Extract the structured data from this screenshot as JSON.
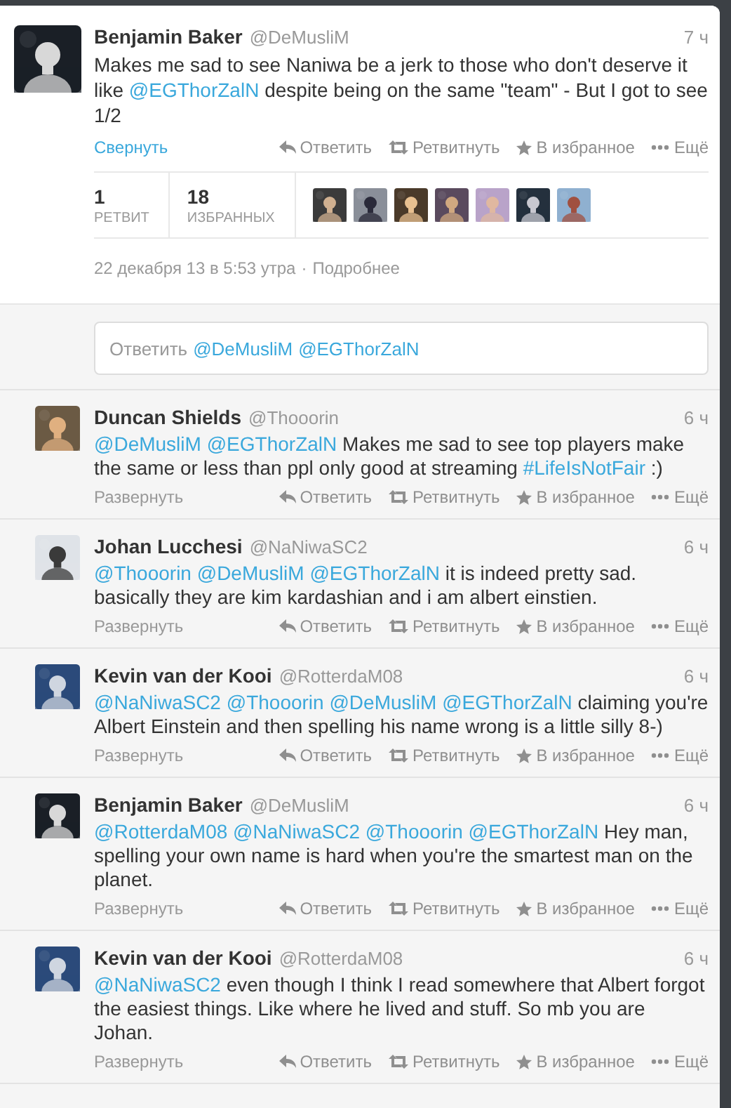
{
  "main_tweet": {
    "name": "Benjamin Baker",
    "handle": "@DeMusliM",
    "time": "7 ч",
    "text": [
      {
        "kind": "text",
        "text": "Makes me sad to see Naniwa be a jerk to those who don't deserve it like "
      },
      {
        "kind": "mention",
        "text": "@EGThorZalN"
      },
      {
        "kind": "text",
        "text": " despite being on the same \"team\" - But I got to see 1/2"
      }
    ],
    "toggle": {
      "label": "Свернуть",
      "expanded": true
    },
    "actions": [
      {
        "kind": "reply",
        "label": "Ответить"
      },
      {
        "kind": "retweet",
        "label": "Ретвитнуть"
      },
      {
        "kind": "favorite",
        "label": "В избранное"
      },
      {
        "kind": "more",
        "label": "Ещё"
      }
    ],
    "stats": [
      {
        "count": "1",
        "label": "РЕТВИТ"
      },
      {
        "count": "18",
        "label": "ИЗБРАННЫХ"
      }
    ],
    "date": "22 декабря 13 в 5:53 утра",
    "separator": "·",
    "details_link": "Подробнее"
  },
  "reply_box": {
    "prompt": "Ответить",
    "mentions": [
      "@DeMusliM",
      "@EGThorZalN"
    ]
  },
  "replies": [
    {
      "name": "Duncan Shields",
      "handle": "@Thooorin",
      "time": "6 ч",
      "text": [
        {
          "kind": "mention",
          "text": "@DeMusliM "
        },
        {
          "kind": "mention",
          "text": "@EGThorZalN"
        },
        {
          "kind": "text",
          "text": " Makes me sad to see top players make the same or less than ppl only good at streaming "
        },
        {
          "kind": "mention",
          "text": "#LifeIsNotFair"
        },
        {
          "kind": "text",
          "text": " :)"
        }
      ],
      "toggle": {
        "label": "Развернуть",
        "expanded": false
      },
      "actions": [
        {
          "kind": "reply",
          "label": "Ответить"
        },
        {
          "kind": "retweet",
          "label": "Ретвитнуть"
        },
        {
          "kind": "favorite",
          "label": "В избранное"
        },
        {
          "kind": "more",
          "label": "Ещё"
        }
      ]
    },
    {
      "name": "Johan Lucchesi",
      "handle": "@NaNiwaSC2",
      "time": "6 ч",
      "text": [
        {
          "kind": "mention",
          "text": "@Thooorin "
        },
        {
          "kind": "mention",
          "text": "@DeMusliM "
        },
        {
          "kind": "mention",
          "text": "@EGThorZalN"
        },
        {
          "kind": "text",
          "text": " it is indeed pretty sad. basically they are kim kardashian and i am albert einstien."
        }
      ],
      "toggle": {
        "label": "Развернуть",
        "expanded": false
      },
      "actions": [
        {
          "kind": "reply",
          "label": "Ответить"
        },
        {
          "kind": "retweet",
          "label": "Ретвитнуть"
        },
        {
          "kind": "favorite",
          "label": "В избранное"
        },
        {
          "kind": "more",
          "label": "Ещё"
        }
      ]
    },
    {
      "name": "Kevin van der Kooi",
      "handle": "@RotterdaM08",
      "time": "6 ч",
      "text": [
        {
          "kind": "mention",
          "text": "@NaNiwaSC2 "
        },
        {
          "kind": "mention",
          "text": "@Thooorin "
        },
        {
          "kind": "mention",
          "text": "@DeMusliM "
        },
        {
          "kind": "mention",
          "text": "@EGThorZalN"
        },
        {
          "kind": "text",
          "text": " claiming you're Albert Einstein and then spelling his name wrong is a little silly 8-)"
        }
      ],
      "toggle": {
        "label": "Развернуть",
        "expanded": false
      },
      "actions": [
        {
          "kind": "reply",
          "label": "Ответить"
        },
        {
          "kind": "retweet",
          "label": "Ретвитнуть"
        },
        {
          "kind": "favorite",
          "label": "В избранное"
        },
        {
          "kind": "more",
          "label": "Ещё"
        }
      ]
    },
    {
      "name": "Benjamin Baker",
      "handle": "@DeMusliM",
      "time": "6 ч",
      "text": [
        {
          "kind": "mention",
          "text": "@RotterdaM08 "
        },
        {
          "kind": "mention",
          "text": "@NaNiwaSC2 "
        },
        {
          "kind": "mention",
          "text": "@Thooorin "
        },
        {
          "kind": "mention",
          "text": "@EGThorZalN"
        },
        {
          "kind": "text",
          "text": " Hey man, spelling your own name is hard when you're the smartest man on the planet."
        }
      ],
      "toggle": {
        "label": "Развернуть",
        "expanded": false
      },
      "actions": [
        {
          "kind": "reply",
          "label": "Ответить"
        },
        {
          "kind": "retweet",
          "label": "Ретвитнуть"
        },
        {
          "kind": "favorite",
          "label": "В избранное"
        },
        {
          "kind": "more",
          "label": "Ещё"
        }
      ]
    },
    {
      "name": "Kevin van der Kooi",
      "handle": "@RotterdaM08",
      "time": "6 ч",
      "text": [
        {
          "kind": "mention",
          "text": "@NaNiwaSC2"
        },
        {
          "kind": "text",
          "text": " even though I think I read somewhere that Albert forgot the easiest things. Like where he lived and stuff. So mb you are Johan."
        }
      ],
      "toggle": {
        "label": "Развернуть",
        "expanded": false
      },
      "actions": [
        {
          "kind": "reply",
          "label": "Ответить"
        },
        {
          "kind": "retweet",
          "label": "Ретвитнуть"
        },
        {
          "kind": "favorite",
          "label": "В избранное"
        },
        {
          "kind": "more",
          "label": "Ещё"
        }
      ]
    }
  ]
}
